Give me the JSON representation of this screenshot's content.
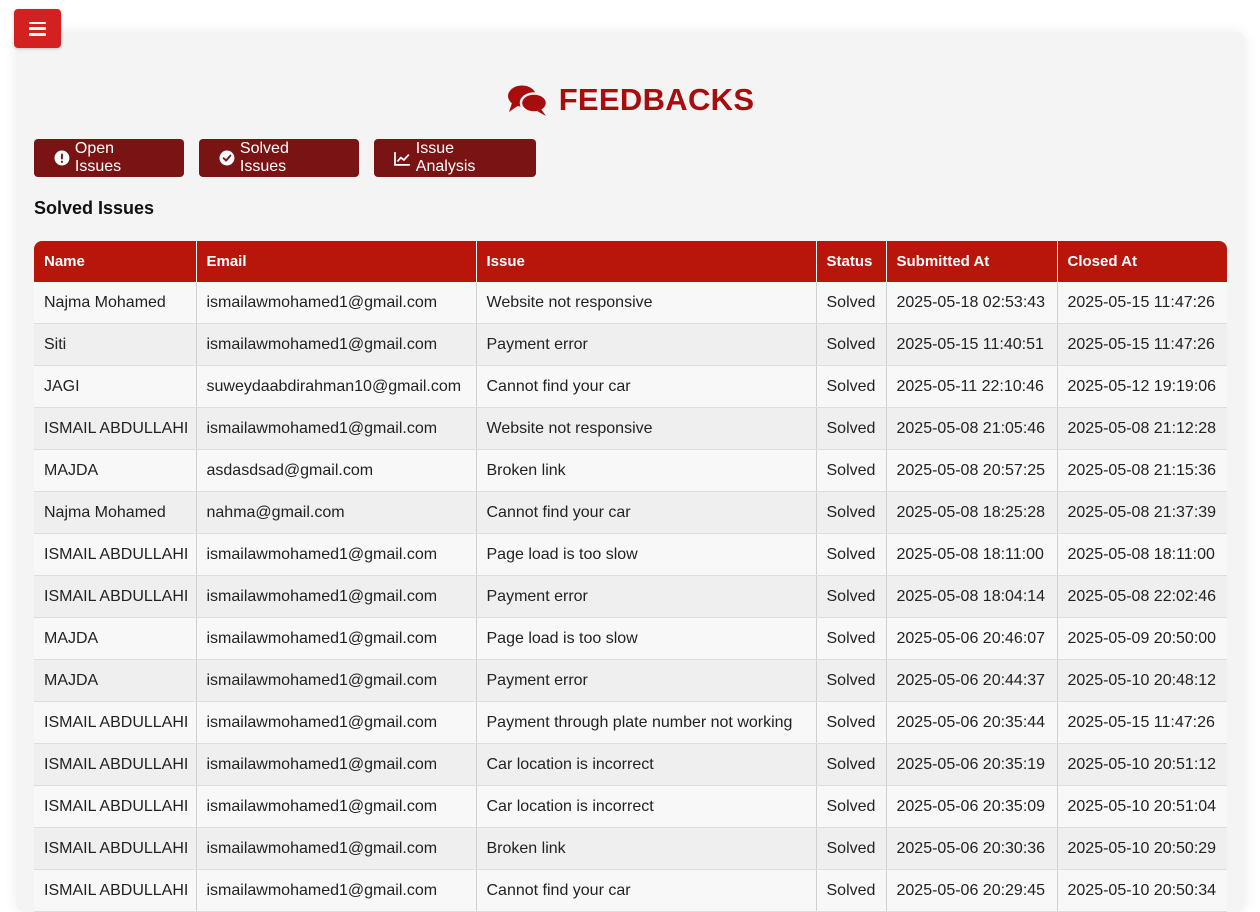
{
  "header": {
    "menu_icon": "hamburger-icon",
    "title": "FEEDBACKS",
    "title_icon": "comments-icon",
    "accent_color": "#a80d0d"
  },
  "buttons": {
    "open_issues": "Open Issues",
    "solved_issues": "Solved Issues",
    "issue_analysis": "Issue Analysis"
  },
  "section_title": "Solved Issues",
  "table": {
    "columns": [
      "Name",
      "Email",
      "Issue",
      "Status",
      "Submitted At",
      "Closed At"
    ],
    "rows": [
      [
        "Najma Mohamed",
        "ismailawmohamed1@gmail.com",
        "Website not responsive",
        "Solved",
        "2025-05-18 02:53:43",
        "2025-05-15 11:47:26"
      ],
      [
        "Siti",
        "ismailawmohamed1@gmail.com",
        "Payment error",
        "Solved",
        "2025-05-15 11:40:51",
        "2025-05-15 11:47:26"
      ],
      [
        "JAGI",
        "suweydaabdirahman10@gmail.com",
        "Cannot find your car",
        "Solved",
        "2025-05-11 22:10:46",
        "2025-05-12 19:19:06"
      ],
      [
        "ISMAIL ABDULLAHI",
        "ismailawmohamed1@gmail.com",
        "Website not responsive",
        "Solved",
        "2025-05-08 21:05:46",
        "2025-05-08 21:12:28"
      ],
      [
        "MAJDA",
        "asdasdsad@gmail.com",
        "Broken link",
        "Solved",
        "2025-05-08 20:57:25",
        "2025-05-08 21:15:36"
      ],
      [
        "Najma Mohamed",
        "nahma@gmail.com",
        "Cannot find your car",
        "Solved",
        "2025-05-08 18:25:28",
        "2025-05-08 21:37:39"
      ],
      [
        "ISMAIL ABDULLAHI",
        "ismailawmohamed1@gmail.com",
        "Page load is too slow",
        "Solved",
        "2025-05-08 18:11:00",
        "2025-05-08 18:11:00"
      ],
      [
        "ISMAIL ABDULLAHI",
        "ismailawmohamed1@gmail.com",
        "Payment error",
        "Solved",
        "2025-05-08 18:04:14",
        "2025-05-08 22:02:46"
      ],
      [
        "MAJDA",
        "ismailawmohamed1@gmail.com",
        "Page load is too slow",
        "Solved",
        "2025-05-06 20:46:07",
        "2025-05-09 20:50:00"
      ],
      [
        "MAJDA",
        "ismailawmohamed1@gmail.com",
        "Payment error",
        "Solved",
        "2025-05-06 20:44:37",
        "2025-05-10 20:48:12"
      ],
      [
        "ISMAIL ABDULLAHI",
        "ismailawmohamed1@gmail.com",
        "Payment through plate number not working",
        "Solved",
        "2025-05-06 20:35:44",
        "2025-05-15 11:47:26"
      ],
      [
        "ISMAIL ABDULLAHI",
        "ismailawmohamed1@gmail.com",
        "Car location is incorrect",
        "Solved",
        "2025-05-06 20:35:19",
        "2025-05-10 20:51:12"
      ],
      [
        "ISMAIL ABDULLAHI",
        "ismailawmohamed1@gmail.com",
        "Car location is incorrect",
        "Solved",
        "2025-05-06 20:35:09",
        "2025-05-10 20:51:04"
      ],
      [
        "ISMAIL ABDULLAHI",
        "ismailawmohamed1@gmail.com",
        "Broken link",
        "Solved",
        "2025-05-06 20:30:36",
        "2025-05-10 20:50:29"
      ],
      [
        "ISMAIL ABDULLAHI",
        "ismailawmohamed1@gmail.com",
        "Cannot find your car",
        "Solved",
        "2025-05-06 20:29:45",
        "2025-05-10 20:50:34"
      ]
    ]
  }
}
